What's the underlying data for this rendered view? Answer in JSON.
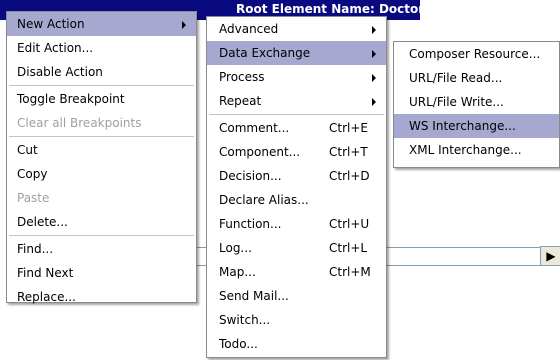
{
  "window": {
    "title_fragment": "Root Element Name: DoctorResp"
  },
  "background": {
    "scroll_arrow": "▶"
  },
  "context_menu": {
    "items": [
      {
        "label": "New Action"
      },
      {
        "label": "Edit Action..."
      },
      {
        "label": "Disable Action"
      },
      {
        "label": "Toggle Breakpoint"
      },
      {
        "label": "Clear all Breakpoints"
      },
      {
        "label": "Cut"
      },
      {
        "label": "Copy"
      },
      {
        "label": "Paste"
      },
      {
        "label": "Delete..."
      },
      {
        "label": "Find..."
      },
      {
        "label": "Find Next"
      },
      {
        "label": "Replace..."
      }
    ]
  },
  "new_action_menu": {
    "items": [
      {
        "label": "Advanced"
      },
      {
        "label": "Data Exchange"
      },
      {
        "label": "Process"
      },
      {
        "label": "Repeat"
      },
      {
        "label": "Comment...",
        "shortcut": "Ctrl+E"
      },
      {
        "label": "Component...",
        "shortcut": "Ctrl+T"
      },
      {
        "label": "Decision...",
        "shortcut": "Ctrl+D"
      },
      {
        "label": "Declare Alias..."
      },
      {
        "label": "Function...",
        "shortcut": "Ctrl+U"
      },
      {
        "label": "Log...",
        "shortcut": "Ctrl+L"
      },
      {
        "label": "Map...",
        "shortcut": "Ctrl+M"
      },
      {
        "label": "Send Mail..."
      },
      {
        "label": "Switch..."
      },
      {
        "label": "Todo..."
      }
    ]
  },
  "data_exchange_menu": {
    "items": [
      {
        "label": "Composer Resource..."
      },
      {
        "label": "URL/File Read..."
      },
      {
        "label": "URL/File Write..."
      },
      {
        "label": "WS Interchange..."
      },
      {
        "label": "XML Interchange..."
      }
    ]
  },
  "colors": {
    "highlight": "#a6a8d0",
    "title_bar": "#0a0a80",
    "disabled_text": "#a0a0a0"
  }
}
